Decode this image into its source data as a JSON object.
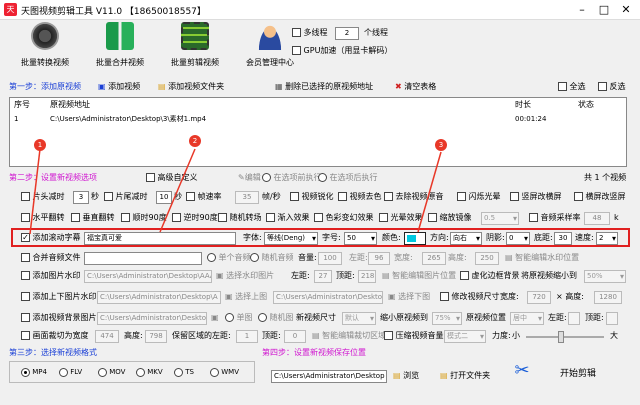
{
  "app": {
    "title": "天图视频剪辑工具 V11.0 【18650018557】"
  },
  "toolbar": {
    "batch_convert": "批量转换视频",
    "batch_merge": "批量合并视频",
    "batch_edit": "批量剪辑视频",
    "member": "会员管理中心",
    "multithread": "多线程",
    "threads": "2",
    "threads_unit": "个线程",
    "gpu": "GPU加速（用显卡解码）"
  },
  "step1": {
    "title": "第一步：添加原视频",
    "add_video": "添加视频",
    "add_folder": "添加视频文件夹",
    "delete_selected": "删除已选择的原视频地址",
    "clear": "清空表格",
    "select_all": "全选",
    "invert": "反选"
  },
  "table": {
    "headers": [
      "序号",
      "原视频地址",
      "时长",
      "状态"
    ],
    "rows": [
      [
        "1",
        "C:\\Users\\Administrator\\Desktop\\3\\素材1.mp4",
        "00:01:24",
        ""
      ]
    ]
  },
  "step2": {
    "title": "第二步：设置新视频选项",
    "advanced": "高级自定义",
    "edit": "编辑",
    "before": "在选项前执行",
    "after": "在选项后执行",
    "count": "共 1 个视频"
  },
  "r1": {
    "cut_head": "片头减时",
    "cut_head_v": "3",
    "sec": "秒",
    "cut_tail": "片尾减时",
    "cut_tail_v": "10",
    "fps_label": "帧速率",
    "fps_v": "35",
    "fps_unit": "帧/秒",
    "sharpen": "视频锐化",
    "color": "视频去色",
    "remove_audio": "去除视频原音",
    "flash": "闪烁光晕",
    "v_blur": "竖屏改横屏",
    "h_blur": "横屏改竖屏"
  },
  "r2": {
    "h_flip": "水平翻转",
    "v_flip": "垂直翻转",
    "cw90": "顺时90度",
    "ccw90": "逆时90度",
    "random": "随机转场",
    "fade": "渐入效果",
    "colorful": "色彩变幻效果",
    "light": "光晕效果",
    "zoom": "缩放镜像",
    "zoom_v": "0.5",
    "sample": "音频采样率",
    "sample_v": "48",
    "sample_unit": "k"
  },
  "r3": {
    "scroll": "添加滚动字幕",
    "text": "福宝真可爱",
    "font_label": "字体",
    "font": "等线(Deng)",
    "size_label": "字号",
    "size": "50",
    "color_label": "颜色",
    "dir_label": "方向",
    "dir": "向右",
    "shadow_label": "阴影",
    "shadow": "0",
    "bottom_label": "底距",
    "bottom": "30",
    "speed_label": "速度",
    "speed": "2"
  },
  "r4": {
    "merge_audio": "合并音频文件",
    "single": "单个音频",
    "random": "随机音频",
    "volume_label": "音量",
    "volume": "100",
    "width_label": "宽度",
    "width": "265",
    "height_label": "高度",
    "height": "250",
    "left_label": "左距",
    "left": "96",
    "edit_img": "智能编辑水印位置"
  },
  "r5": {
    "img_wm": "添加图片水印",
    "path": "C:\\Users\\Administrator\\Desktop\\AAA\\图片",
    "sel_wm": "选择水印图片",
    "left_label": "左距",
    "left": "27",
    "top_label": "顶距",
    "top": "218",
    "edit_img": "智能编辑图片位置",
    "blur_bg": "虚化边框背景",
    "scale": "将原视频缩小到",
    "scale_v": "50%"
  },
  "r6": {
    "add_updown": "添加上下图片水印",
    "path1": "C:\\Users\\Administrator\\Desktop\\A",
    "sel_up": "选择上图",
    "path2": "C:\\Users\\Administrator\\Desktop",
    "sel_down": "选择下图",
    "resize": "修改视频尺寸",
    "w_label": "宽度",
    "w": "720",
    "h_label": "高度",
    "h": "1280"
  },
  "r7": {
    "add_bg": "添加视频背景图片",
    "path": "C:\\Users\\Administrator\\Desktop\\AAA\\图",
    "single": "单图",
    "random": "随机图",
    "newsize": "新视频尺寸",
    "newsize_v": "默认",
    "shrink": "缩小原视频到",
    "shrink_v": "75%",
    "pos": "原视频位置",
    "pos_v": "居中",
    "left_label": "左距",
    "top_label": "顶距"
  },
  "r8": {
    "crop": "画面裁切为宽度",
    "crop_w": "474",
    "h_label": "高度",
    "crop_h": "798",
    "keep": "保留区域的左距",
    "keep_v": "1",
    "top_label": "顶距",
    "top_v": "0",
    "edit": "智能编辑裁切区域",
    "compress": "压缩视频音量",
    "compress_v": "模式二",
    "force": "力度",
    "force_small": "小",
    "force_big": "大",
    "force_level": 0.45
  },
  "step3": {
    "title": "第三步：选择新视频格式",
    "formats": [
      "MP4",
      "FLV",
      "MOV",
      "MKV",
      "TS",
      "WMV"
    ],
    "selected": "MP4"
  },
  "step4": {
    "title": "第四步：设置新视频保存位置",
    "path": "C:\\Users\\Administrator\\Desktop",
    "browse": "浏览",
    "open": "打开文件夹",
    "start": "开始剪辑"
  },
  "markers": [
    "1",
    "2",
    "3"
  ],
  "colors": {
    "accent": "#1a3fd6",
    "step_magenta": "#d016d0",
    "highlight": "#e02020",
    "marker": "#e83828",
    "color_swatch": "#00c8e0"
  }
}
